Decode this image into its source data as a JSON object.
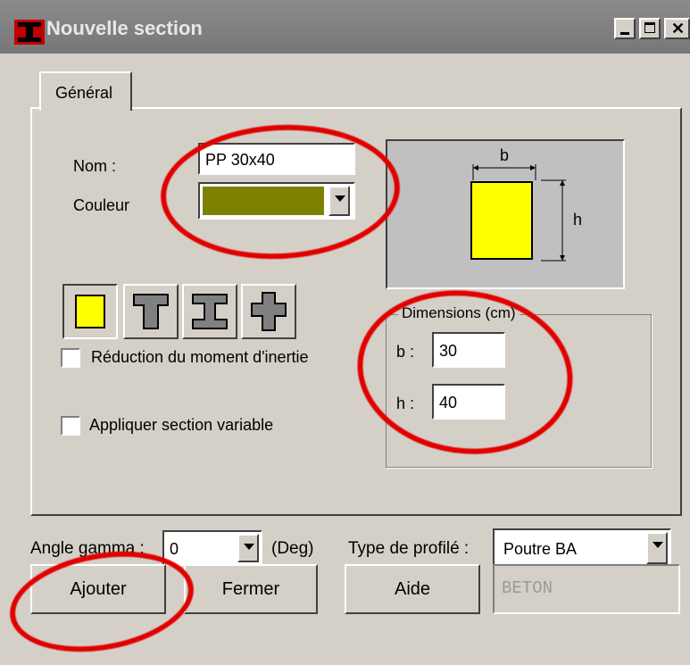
{
  "window": {
    "title": "Nouvelle section"
  },
  "tabs": [
    {
      "label": "Général"
    }
  ],
  "form": {
    "nom_label": "Nom :",
    "nom_value": "PP 30x40",
    "couleur_label": "Couleur",
    "couleur_value": "#808000"
  },
  "preview": {
    "b_label": "b",
    "h_label": "h",
    "fill_color": "#ffff00"
  },
  "checkboxes": {
    "reduction_label": "Réduction du moment d'inertie",
    "variable_label": "Appliquer section variable"
  },
  "dimensions": {
    "title": "Dimensions (cm)",
    "b_label": "b :",
    "b_value": "30",
    "h_label": "h :",
    "h_value": "40"
  },
  "bottom": {
    "angle_label": "Angle gamma :",
    "angle_value": "0",
    "angle_unit": "(Deg)",
    "type_label": "Type de profilé :",
    "type_value": "Poutre BA",
    "material_value": "BETON"
  },
  "buttons": {
    "ajouter": "Ajouter",
    "fermer": "Fermer",
    "aide": "Aide"
  },
  "colors": {
    "annotation_red": "#e00000",
    "dialog_bg": "#d4d0c8"
  }
}
